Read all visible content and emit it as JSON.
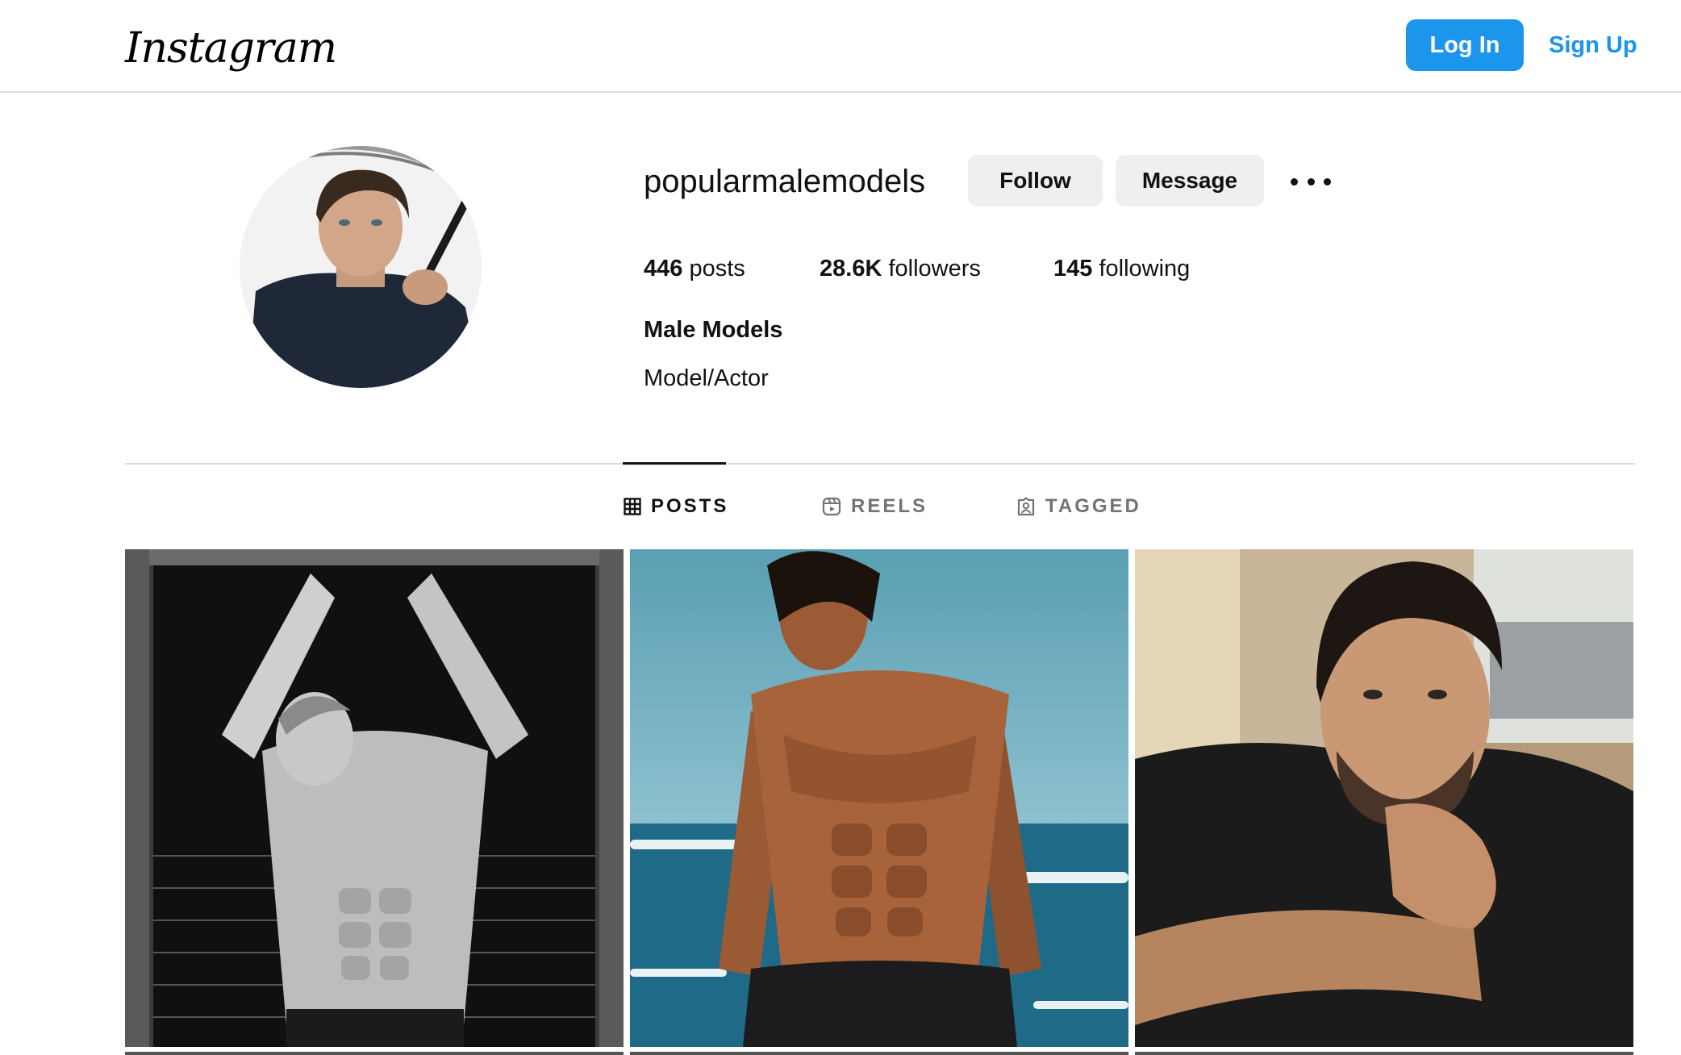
{
  "header": {
    "logo_text": "Instagram",
    "login_label": "Log In",
    "signup_label": "Sign Up",
    "accent_color": "#1c95ec"
  },
  "profile": {
    "username": "popularmalemodels",
    "follow_label": "Follow",
    "message_label": "Message",
    "more_icon": "more-horizontal-icon",
    "stats": {
      "posts_count": "446",
      "posts_label": "posts",
      "followers_count": "28.6K",
      "followers_label": "followers",
      "following_count": "145",
      "following_label": "following"
    },
    "full_name": "Male Models",
    "bio": "Model/Actor"
  },
  "tabs": [
    {
      "label": "POSTS",
      "icon": "grid-icon",
      "active": true
    },
    {
      "label": "REELS",
      "icon": "reels-icon",
      "active": false
    },
    {
      "label": "TAGGED",
      "icon": "tagged-icon",
      "active": false
    }
  ],
  "posts": [
    {
      "description": "black-and-white-photo"
    },
    {
      "description": "beach-photo"
    },
    {
      "description": "indoor-portrait-photo"
    }
  ]
}
